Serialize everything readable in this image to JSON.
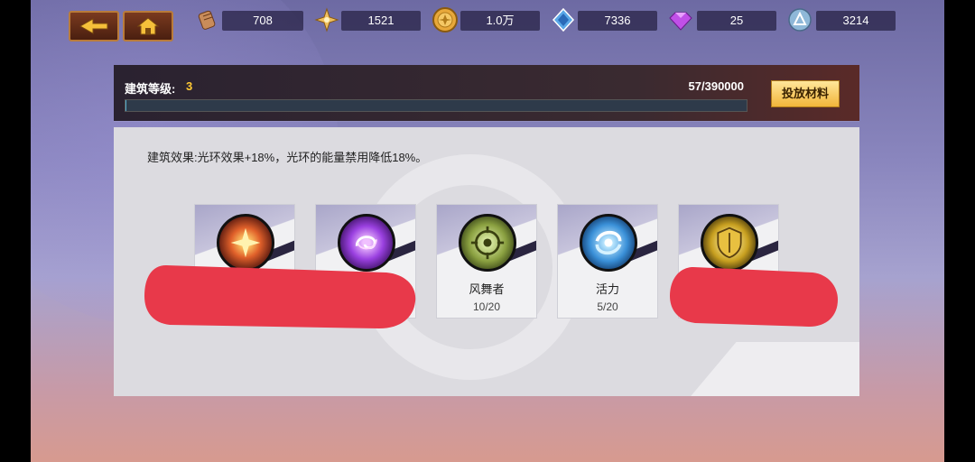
{
  "nav": {
    "back_icon": "back-arrow-icon",
    "home_icon": "home-icon"
  },
  "resources": [
    {
      "icon": "scroll-icon",
      "value": "708"
    },
    {
      "icon": "star-compass-icon",
      "value": "1521"
    },
    {
      "icon": "gold-coin-icon",
      "value": "1.0万"
    },
    {
      "icon": "blue-crystal-icon",
      "value": "7336"
    },
    {
      "icon": "purple-gem-icon",
      "value": "25"
    },
    {
      "icon": "silver-orb-icon",
      "value": "3214"
    }
  ],
  "building": {
    "level_label": "建筑等级:",
    "level_value": "3",
    "progress_text": "57/390000",
    "progress_fraction": 0.000146,
    "deposit_button": "投放材料",
    "effect_text": "建筑效果:光环效果+18%，光环的能量禁用降低18%。"
  },
  "cards": [
    {
      "icon": "flame-burst-icon",
      "name": "",
      "count": "",
      "redacted": true
    },
    {
      "icon": "purple-swirl-icon",
      "name": "",
      "count": "",
      "redacted": true
    },
    {
      "icon": "target-icon",
      "name": "风舞者",
      "count": "10/20"
    },
    {
      "icon": "blue-vortex-icon",
      "name": "活力",
      "count": "5/20"
    },
    {
      "icon": "golden-shield-icon",
      "name": "",
      "count": "",
      "redacted": true
    }
  ],
  "colors": {
    "level_value": "#ffc933",
    "redaction": "#e8394a",
    "deposit_button": "#f2b53a"
  }
}
